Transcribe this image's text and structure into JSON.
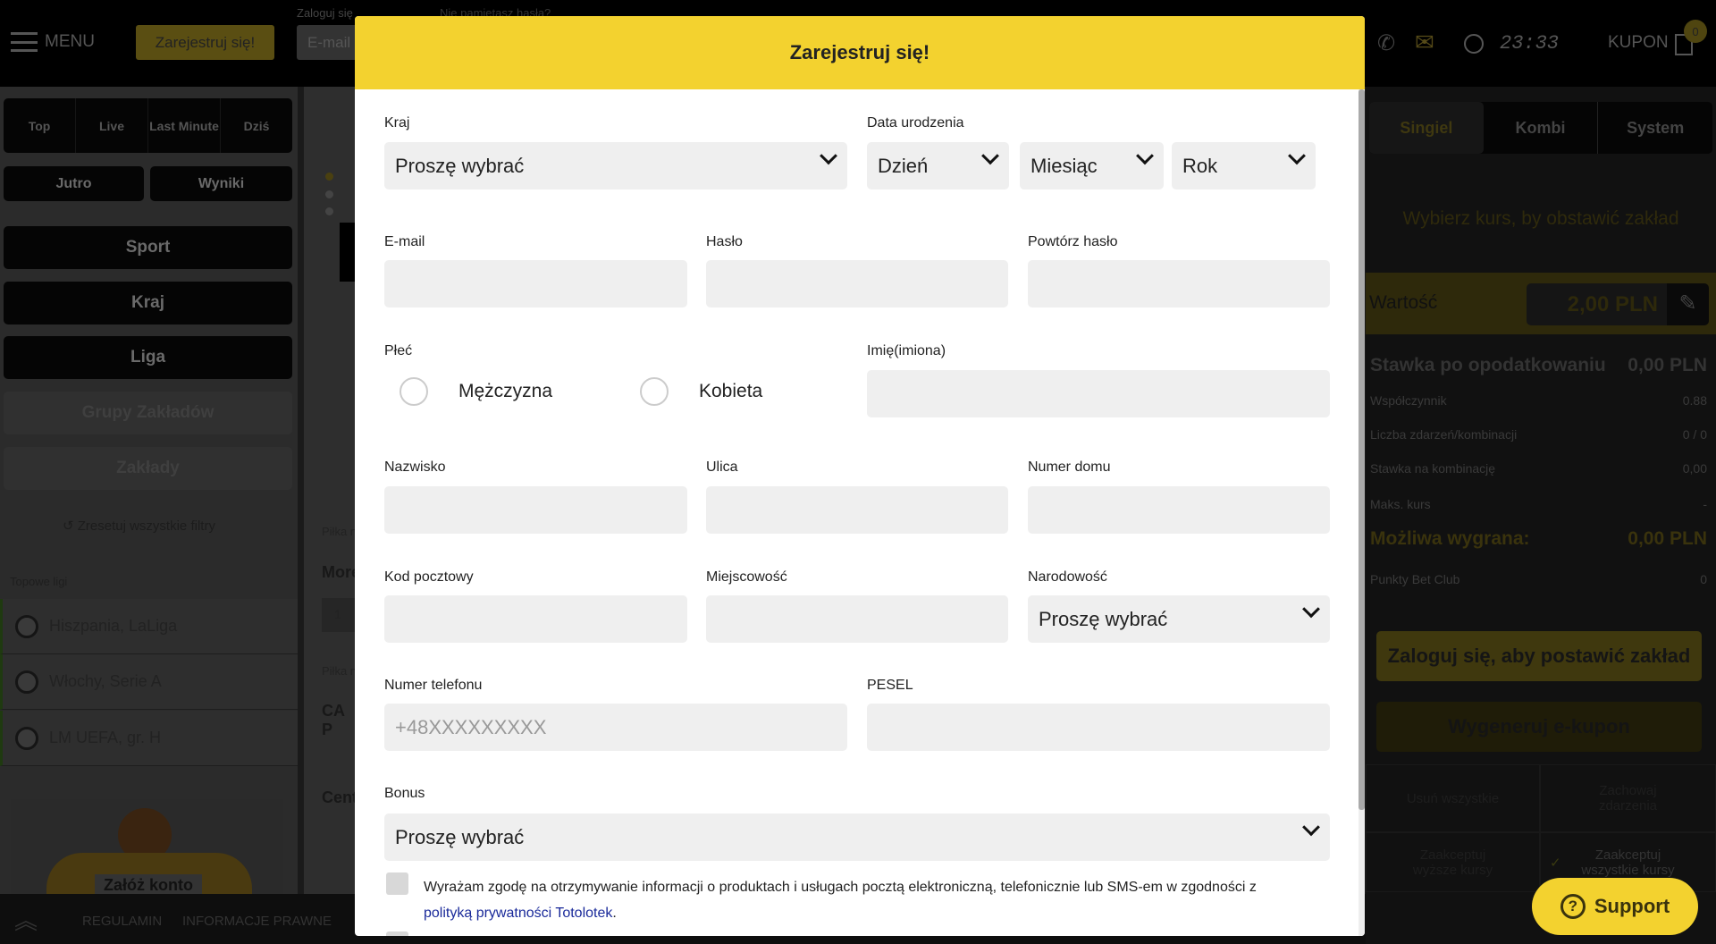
{
  "topbar": {
    "menu_label": "MENU",
    "register_label": "Zarejestruj się!",
    "login_label": "Zaloguj się",
    "email_placeholder": "E-mail",
    "forgot_label": "Nie pamiętasz hasła?",
    "time": "23:33",
    "coupon_label": "KUPON",
    "coupon_count": "0"
  },
  "sidebar": {
    "tabs": [
      "Top",
      "Live",
      "Last Minute",
      "Dziś"
    ],
    "jutro": "Jutro",
    "wyniki": "Wyniki",
    "filters": [
      "Sport",
      "Kraj",
      "Liga",
      "Grupy Zakładów",
      "Zakłady"
    ],
    "reset": "Zresetuj wszystkie filtry",
    "top_leagues_title": "Topowe ligi",
    "leagues": [
      "Hiszpania, LaLiga",
      "Włochy, Serie A",
      "LM UEFA, gr. H"
    ],
    "promo": "Załóż konto"
  },
  "middle": {
    "sport1": "Piłka n",
    "event1": "More",
    "sport2": "Piłka n",
    "event2": "CA P",
    "event3": "Cent",
    "odd": "1"
  },
  "footer": {
    "links": [
      "REGULAMIN",
      "INFORMACJE PRAWNE"
    ]
  },
  "betslip": {
    "tabs": [
      "Singiel",
      "Kombi",
      "System"
    ],
    "hint": "Wybierz kurs, by obstawić zakład",
    "value_label": "Wartość",
    "value": "2,00 PLN",
    "stake_after_tax_label": "Stawka po opodatkowaniu",
    "stake_after_tax": "0,00 PLN",
    "rows": [
      {
        "label": "Współczynnik",
        "value": "0.88"
      },
      {
        "label": "Liczba zdarzeń/kombinacji",
        "value": "0 / 0"
      },
      {
        "label": "Stawka na kombinację",
        "value": "0,00"
      },
      {
        "label": "Maks. kurs",
        "value": "-"
      }
    ],
    "win_label": "Możliwa wygrana:",
    "win_value": "0,00 PLN",
    "points_label": "Punkty Bet Club",
    "points_value": "0",
    "login_button": "Zaloguj się, aby postawić zakład",
    "ecoupon_button": "Wygeneruj e-kupon",
    "remove_all": "Usuń wszystkie",
    "keep_events": "Zachowaj zdarzenia",
    "accept_higher": "Zaakceptuj wyższe kursy",
    "accept_all": "Zaakceptuj wszystkie kursy"
  },
  "support": {
    "label": "Support"
  },
  "modal": {
    "title": "Zarejestruj się!",
    "country": {
      "label": "Kraj",
      "value": "Proszę wybrać"
    },
    "birth": {
      "label": "Data urodzenia",
      "day": "Dzień",
      "month": "Miesiąc",
      "year": "Rok"
    },
    "email": {
      "label": "E-mail",
      "value": ""
    },
    "password": {
      "label": "Hasło",
      "value": ""
    },
    "password_repeat": {
      "label": "Powtórz hasło",
      "value": ""
    },
    "gender": {
      "label": "Płeć",
      "options": [
        "Mężczyzna",
        "Kobieta"
      ],
      "selected": null
    },
    "first_name": {
      "label": "Imię(imiona)",
      "value": ""
    },
    "last_name": {
      "label": "Nazwisko",
      "value": ""
    },
    "street": {
      "label": "Ulica",
      "value": ""
    },
    "house": {
      "label": "Numer domu",
      "value": ""
    },
    "postal": {
      "label": "Kod pocztowy",
      "value": ""
    },
    "city": {
      "label": "Miejscowość",
      "value": ""
    },
    "nationality": {
      "label": "Narodowość",
      "value": "Proszę wybrać"
    },
    "phone": {
      "label": "Numer telefonu",
      "placeholder": "+48XXXXXXXXX",
      "value": ""
    },
    "pesel": {
      "label": "PESEL",
      "value": ""
    },
    "bonus": {
      "label": "Bonus",
      "value": "Proszę wybrać"
    },
    "consent": {
      "text": "Wyrażam zgodę na otrzymywanie informacji o produktach i usługach pocztą elektroniczną, telefonicznie lub SMS-em w zgodności z",
      "link": "polityką prywatności Totolotek",
      "suffix": ".",
      "checked": false
    }
  },
  "colors": {
    "accent": "#f3d22f",
    "link": "#1a2a9a"
  }
}
